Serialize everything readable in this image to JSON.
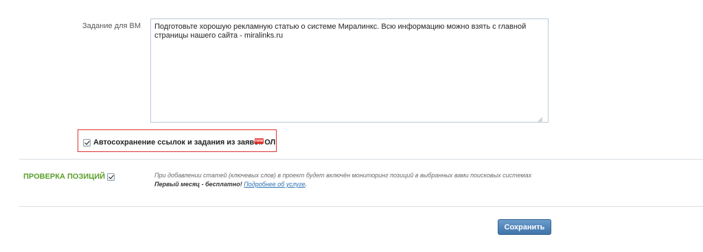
{
  "task": {
    "label": "Задание для ВМ",
    "text": "Подготовьте хорошую рекламную статью о системе Миралинкс. Всю информацию можно взять с главной\nстраницы нашего сайта - miralinks.ru"
  },
  "autosave": {
    "label": "Автосохранение ссылок и задания из заявок ОЛ",
    "checked": true,
    "badge": "new"
  },
  "positions": {
    "title": "ПРОВЕРКА ПОЗИЦИЙ",
    "checked": true,
    "note": "При добавлении статей (ключевых слов) в проект будет включён мониторинг позиций в выбранных вами поисковых системах",
    "promo_bold": "Первый месяц - бесплатно!",
    "more_link": "Подробнее об услуге",
    "more_suffix": "."
  },
  "actions": {
    "save_label": "Сохранить"
  },
  "colors": {
    "accent_green": "#5a9e2a",
    "button_blue": "#4a7fb3",
    "highlight_red": "#e03030"
  }
}
